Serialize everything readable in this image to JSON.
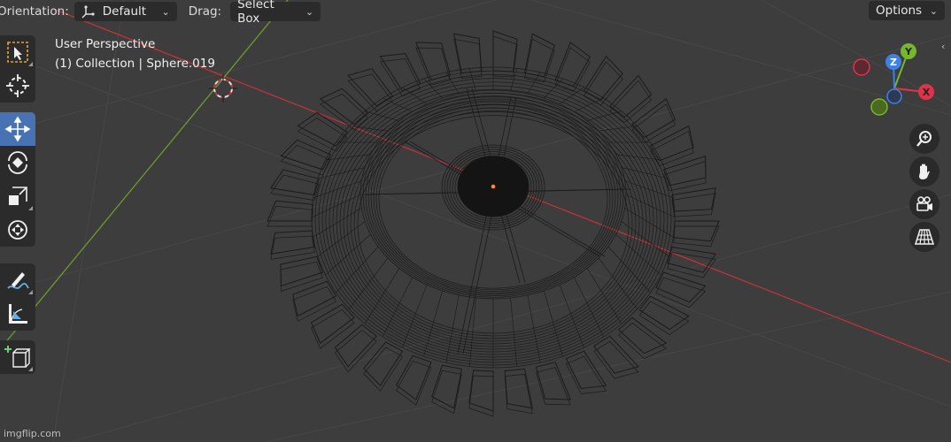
{
  "header": {
    "orientation_label": "Orientation:",
    "orientation_value": "Default",
    "drag_label": "Drag:",
    "drag_value": "Select Box",
    "options_label": "Options"
  },
  "viewport": {
    "view_name": "User Perspective",
    "collection_info": "(1) Collection | Sphere.019"
  },
  "gizmo": {
    "axes": [
      {
        "label": "X",
        "color": "#e0334a"
      },
      {
        "label": "Y",
        "color": "#76b82a"
      },
      {
        "label": "Z",
        "color": "#3d80e6"
      }
    ]
  },
  "toolbar": {
    "tools": [
      {
        "name": "select-box-tool",
        "icon": "select-box-icon",
        "active": false
      },
      {
        "name": "cursor-tool",
        "icon": "cursor-icon",
        "active": false
      },
      {
        "name": "move-tool",
        "icon": "move-icon",
        "active": true
      },
      {
        "name": "rotate-tool",
        "icon": "rotate-icon",
        "active": false
      },
      {
        "name": "scale-tool",
        "icon": "scale-icon",
        "active": false
      },
      {
        "name": "transform-tool",
        "icon": "transform-icon",
        "active": false
      },
      {
        "name": "annotate-tool",
        "icon": "annotate-icon",
        "active": false
      },
      {
        "name": "measure-tool",
        "icon": "measure-icon",
        "active": false
      },
      {
        "name": "add-cube-tool",
        "icon": "add-cube-icon",
        "active": false
      }
    ]
  },
  "navigation": {
    "buttons": [
      "zoom-icon",
      "hand-pan-icon",
      "camera-icon",
      "grid-perspective-icon"
    ]
  },
  "colors": {
    "background": "#3d3d3d",
    "x_axis_line": "#c8323a",
    "y_axis_line": "#6e9a2a",
    "active_tool": "#4772b3",
    "origin_dot": "#ff8c1a"
  },
  "watermark": "imgflip.com"
}
